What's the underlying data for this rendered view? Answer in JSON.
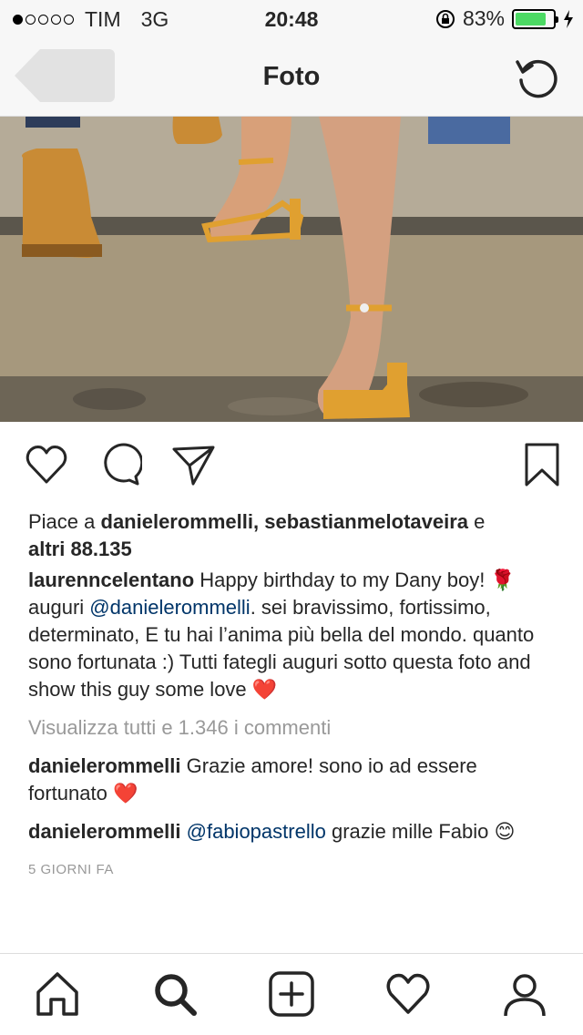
{
  "status_bar": {
    "carrier": "TIM",
    "network": "3G",
    "time": "20:48",
    "battery_percent": "83%",
    "battery_level": 0.83,
    "signal_dots_filled": 1,
    "signal_dots_total": 5
  },
  "header": {
    "title": "Foto"
  },
  "post": {
    "likes_prefix": "Piace a ",
    "likes_users": "danielerommelli, sebastianmelotaveira",
    "likes_and": " e",
    "likes_others": "altri 88.135",
    "caption_user": "laurenncelentano",
    "caption_part1": " Happy birthday to my Dany boy! ",
    "caption_rose": "🌹",
    "caption_part2": " auguri ",
    "caption_mention": "@danielerommelli",
    "caption_part3": ". sei bravissimo, fortissimo, determinato, E tu hai l’anima più bella del mondo. quanto sono fortunata :) Tutti fategli auguri sotto questa foto and show this guy some love ",
    "caption_heart": "❤️",
    "view_all": "Visualizza tutti e 1.346 i commenti",
    "comments": [
      {
        "user": "danielerommelli",
        "text": " Grazie amore! sono io ad essere fortunato ",
        "emoji": "❤️"
      },
      {
        "user": "danielerommelli",
        "mention": "@fabiopastrello",
        "text": " grazie mille Fabio ",
        "emoji": "😊"
      }
    ],
    "time_ago": "5 GIORNI FA"
  },
  "icons": {
    "like": "heart-outline-icon",
    "comment": "speech-bubble-icon",
    "share": "paper-plane-icon",
    "save": "bookmark-icon"
  },
  "tabbar": [
    "home-icon",
    "search-icon",
    "add-post-icon",
    "activity-heart-icon",
    "profile-icon"
  ]
}
